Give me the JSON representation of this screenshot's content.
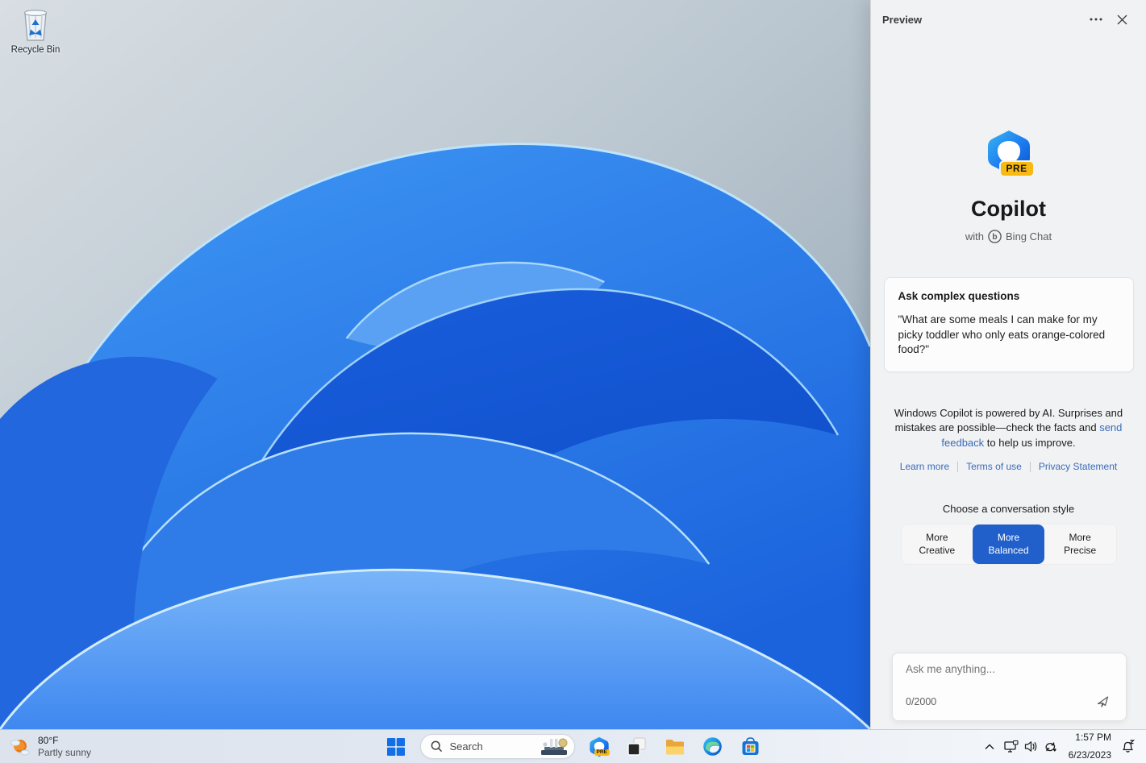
{
  "desktop": {
    "recycle_bin_label": "Recycle Bin"
  },
  "copilot_panel": {
    "header": {
      "title": "Preview"
    },
    "logo_badge": "PRE",
    "title": "Copilot",
    "subtitle_prefix": "with",
    "subtitle_icon_letter": "b",
    "subtitle_brand": "Bing Chat",
    "suggestion_card": {
      "title": "Ask complex questions",
      "quote": "\"What are some meals I can make for my picky toddler who only eats orange-colored food?\""
    },
    "disclaimer": {
      "text_before": "Windows Copilot is powered by AI. Surprises and mistakes are possible—check the facts and ",
      "link": "send feedback",
      "text_after": " to help us improve."
    },
    "links": [
      "Learn more",
      "Terms of use",
      "Privacy Statement"
    ],
    "style_chooser": {
      "label": "Choose a conversation style",
      "options": [
        "More\nCreative",
        "More\nBalanced",
        "More\nPrecise"
      ],
      "selected": "More Balanced"
    },
    "input": {
      "placeholder": "Ask me anything...",
      "counter": "0/2000"
    }
  },
  "taskbar": {
    "weather": {
      "temp": "80°F",
      "condition": "Partly sunny"
    },
    "search": {
      "placeholder": "Search"
    },
    "copilot_badge": "PRE",
    "tray": {
      "time": "1:57 PM",
      "date": "6/23/2023"
    }
  },
  "colors": {
    "accent_blue": "#2160cb",
    "link_blue": "#3b6bb8",
    "pre_badge_amber": "#f8b912",
    "panel_bg": "#f0f2f4",
    "bloom_deep_blue": "#1357d6",
    "bloom_light_blue": "#6fb0f7"
  }
}
